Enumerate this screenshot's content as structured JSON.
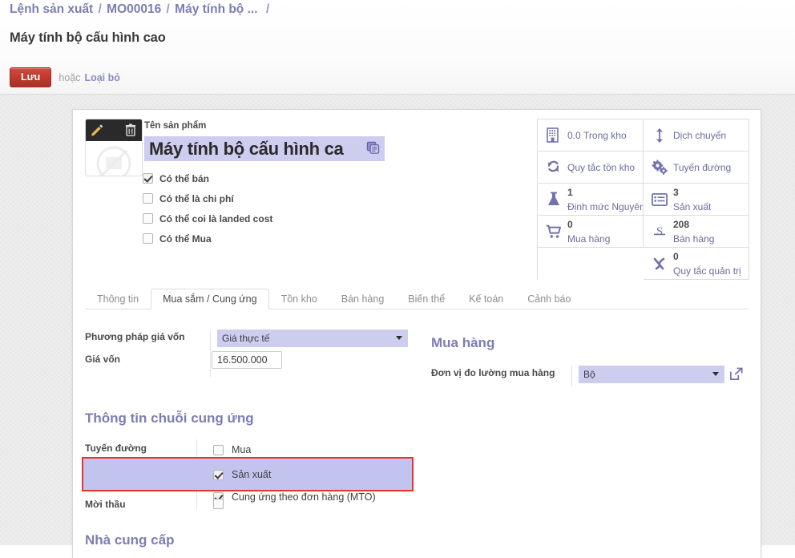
{
  "breadcrumb": {
    "items": [
      "Lệnh sản xuất",
      "MO00016",
      "Máy tính bộ ..."
    ],
    "separator": "/",
    "trailing": "/"
  },
  "record_title": "Máy tính bộ cấu hình cao",
  "actions": {
    "save_label": "Lưu",
    "or_label": "hoặc",
    "discard_label": "Loại bỏ",
    "save_color": "#c0392b"
  },
  "image_widget": {
    "edit_icon": "pencil-icon",
    "delete_icon": "trash-icon",
    "placeholder_icon": "no-image-icon"
  },
  "product": {
    "name_label": "Tên sản phẩm",
    "name_value": "Máy tính bộ cấu hình ca",
    "translate_icon": "translate-icon",
    "checkboxes": [
      {
        "label": "Có thể bán",
        "checked": true
      },
      {
        "label": "Có thể là chi phí",
        "checked": false
      },
      {
        "label": "Có thể coi là landed cost",
        "checked": false
      },
      {
        "label": "Có thể Mua",
        "checked": false
      }
    ]
  },
  "stat_buttons": [
    {
      "icon": "building-icon",
      "value": "0.0",
      "label": "Trong kho",
      "inline": true
    },
    {
      "icon": "arrows-v-icon",
      "value": "",
      "label": "Dịch chuyển",
      "inline": true
    },
    {
      "icon": "refresh-icon",
      "value": "",
      "label": "Quy tắc tồn kho",
      "inline": true
    },
    {
      "icon": "cogs-icon",
      "value": "",
      "label": "Tuyến đường",
      "inline": true
    },
    {
      "icon": "flask-icon",
      "value": "1",
      "label": "Định mức Nguyên",
      "inline": false
    },
    {
      "icon": "list-alt-icon",
      "value": "3",
      "label": "Sản xuất",
      "inline": false
    },
    {
      "icon": "cart-icon",
      "value": "0",
      "label": "Mua hàng",
      "inline": false
    },
    {
      "icon": "strikethrough-s-icon",
      "value": "208",
      "label": "Bán hàng",
      "inline": false
    },
    {
      "icon": "empty",
      "value": "",
      "label": "",
      "inline": false
    },
    {
      "icon": "chi-icon",
      "value": "0",
      "label": "Quy tắc quản trị",
      "inline": false
    }
  ],
  "tabs": [
    {
      "label": "Thông tin",
      "active": false
    },
    {
      "label": "Mua sắm / Cung ứng",
      "active": true
    },
    {
      "label": "Tồn kho",
      "active": false
    },
    {
      "label": "Bán hàng",
      "active": false
    },
    {
      "label": "Biến thể",
      "active": false
    },
    {
      "label": "Kế toán",
      "active": false
    },
    {
      "label": "Cảnh báo",
      "active": false
    }
  ],
  "costing": {
    "method_label": "Phương pháp giá vốn",
    "method_value": "Giá thực tế",
    "cost_label": "Giá vốn",
    "cost_value": "16.500.000"
  },
  "purchase": {
    "heading": "Mua hàng",
    "uom_label": "Đơn vị đo lường mua hàng",
    "uom_value": "Bộ",
    "external_link_icon": "external-link-icon"
  },
  "supply_chain": {
    "heading": "Thông tin chuỗi cung ứng",
    "routes_label": "Tuyến đường",
    "routes": [
      {
        "label": "Mua",
        "checked": false,
        "highlighted": false
      },
      {
        "label": "Sản xuất",
        "checked": true,
        "highlighted": true
      },
      {
        "label": "Cung ứng theo đơn hàng (MTO)",
        "checked": true,
        "highlighted": true
      }
    ],
    "tender_label": "Mời thầu",
    "tender_checked": false,
    "highlight_color": "#e8342a"
  },
  "vendors": {
    "heading": "Nhà cung cấp"
  }
}
